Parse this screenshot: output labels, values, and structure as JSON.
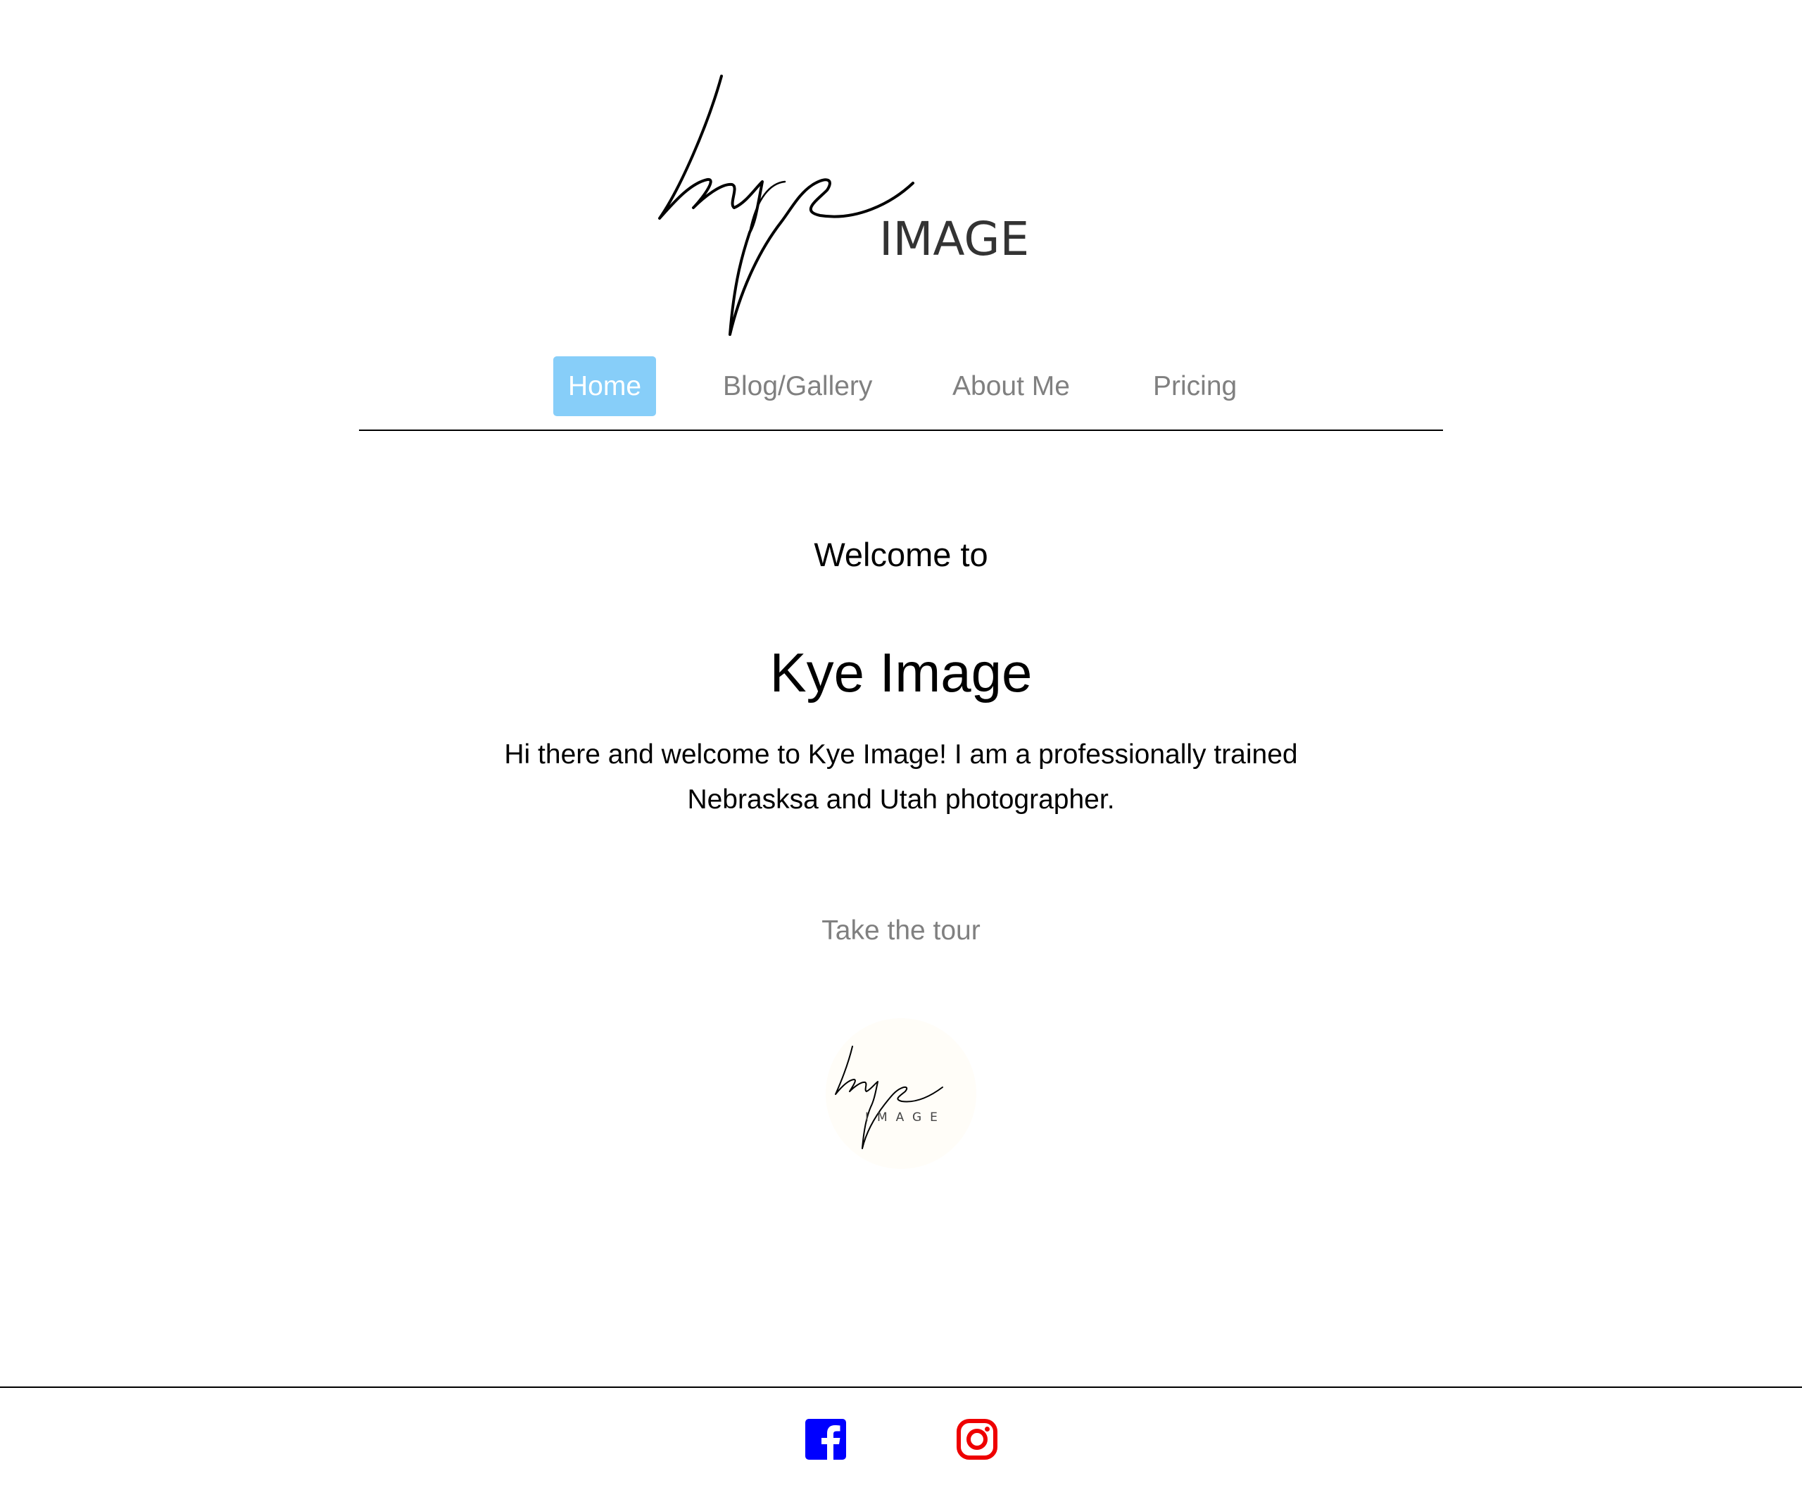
{
  "site": {
    "logo_script": "kye",
    "logo_word": "IMAGE"
  },
  "nav": {
    "items": [
      {
        "label": "Home",
        "active": true
      },
      {
        "label": "Blog/Gallery",
        "active": false
      },
      {
        "label": "About Me",
        "active": false
      },
      {
        "label": "Pricing",
        "active": false
      }
    ]
  },
  "hero": {
    "welcome": "Welcome to",
    "title": "Kye Image",
    "intro": "Hi there and welcome to Kye Image! I am a professionally trained Nebrasksa and Utah photographer.",
    "tour_link": "Take the tour"
  },
  "footer": {
    "icons": [
      {
        "name": "facebook-icon",
        "color": "#0000ff"
      },
      {
        "name": "instagram-icon",
        "color": "#ee0000"
      }
    ]
  },
  "colors": {
    "nav_active_bg": "#87cef9",
    "nav_text": "#808080",
    "text": "#000000"
  }
}
